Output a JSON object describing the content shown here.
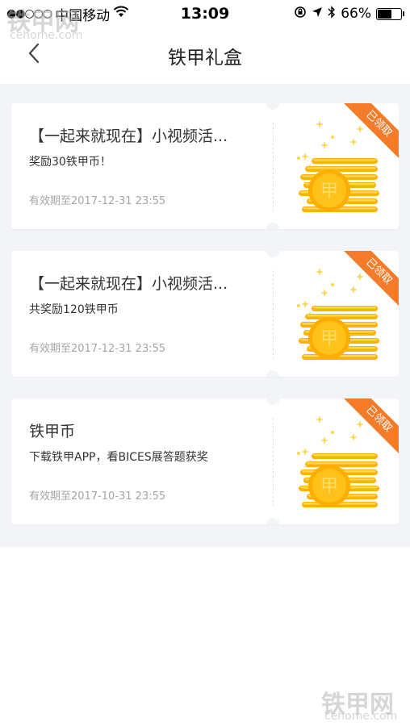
{
  "status_bar": {
    "signal_dots": "●●○○○",
    "carrier": "中国移动",
    "time": "13:09",
    "battery_percent": "66%",
    "battery_level": 0.66
  },
  "nav": {
    "title": "铁甲礼盒"
  },
  "cards": [
    {
      "title": "【一起来就现在】小视频活...",
      "description": "奖励30铁甲币！",
      "validity": "有效期至2017-12-31 23:55",
      "badge": "已领取"
    },
    {
      "title": "【一起来就现在】小视频活...",
      "description": "共奖励120铁甲币",
      "validity": "有效期至2017-12-31 23:55",
      "badge": "已领取"
    },
    {
      "title": "铁甲币",
      "description": "下载铁甲APP，看BICES展答题获奖",
      "validity": "有效期至2017-10-31 23:55",
      "badge": "已领取"
    }
  ],
  "coin_glyph": "甲",
  "watermark": {
    "brand": "铁甲网",
    "domain": "cehome.com"
  },
  "colors": {
    "accent_orange": "#f37b2a",
    "coin_yellow": "#ffc21a",
    "background": "#f3f4f8",
    "muted_text": "#a5a5a5"
  }
}
